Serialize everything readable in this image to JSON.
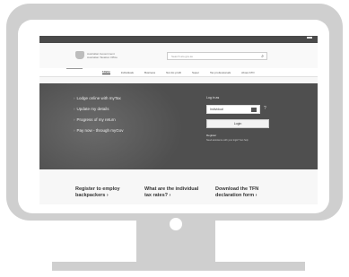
{
  "website": {
    "utility_links": [
      "",
      "",
      ""
    ],
    "agency_name": [
      "Australian Government",
      "Australian Taxation Office"
    ],
    "search_placeholder": "Search ato.gov.au",
    "nav": [
      "Home",
      "Individuals",
      "Business",
      "Not-for-profit",
      "Super",
      "Tax professionals",
      "About ATO"
    ],
    "hero_items": [
      "Lodge online with myTax",
      "Update my details",
      "Progress of my return",
      "Pay now - through myGov"
    ],
    "login": {
      "title": "Log in as",
      "select_value": "Individual",
      "button": "Login",
      "register": "Register",
      "fine_print": "Need assistance with your login? Get help"
    },
    "ctas": [
      [
        "Register to employ",
        "backpackers ›"
      ],
      [
        "What are the individual",
        "tax rates? ›"
      ],
      [
        "Download the TFN",
        "declaration form ›"
      ]
    ]
  }
}
